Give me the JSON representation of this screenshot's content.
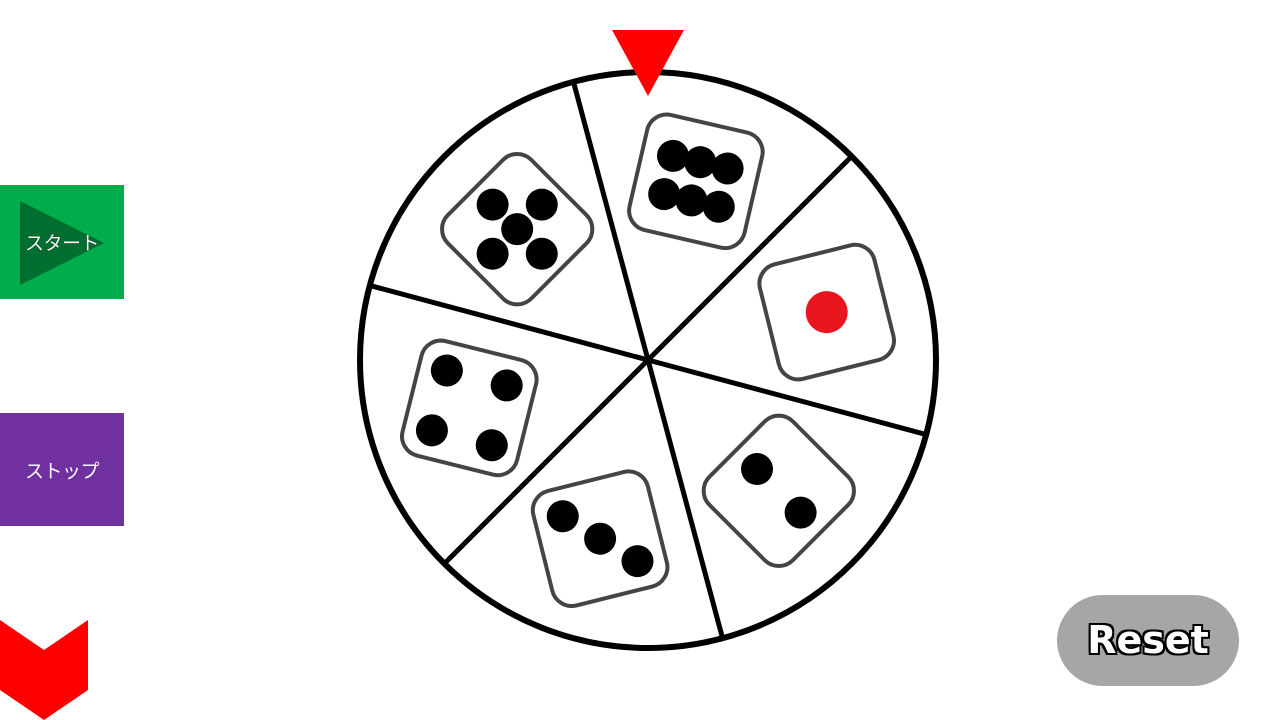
{
  "controls": {
    "start_label": "スタート",
    "stop_label": "ストップ",
    "reset_label": "Reset"
  },
  "wheel": {
    "segments": [
      {
        "value": 6,
        "pip_color": "#000000"
      },
      {
        "value": 1,
        "pip_color": "#e8141e"
      },
      {
        "value": 2,
        "pip_color": "#000000"
      },
      {
        "value": 3,
        "pip_color": "#000000"
      },
      {
        "value": 4,
        "pip_color": "#000000"
      },
      {
        "value": 5,
        "pip_color": "#000000"
      }
    ]
  },
  "colors": {
    "start_button": "#00ad4d",
    "stop_button": "#7030a0",
    "pointer": "#ff0000",
    "reset_button": "#a6a6a6"
  }
}
